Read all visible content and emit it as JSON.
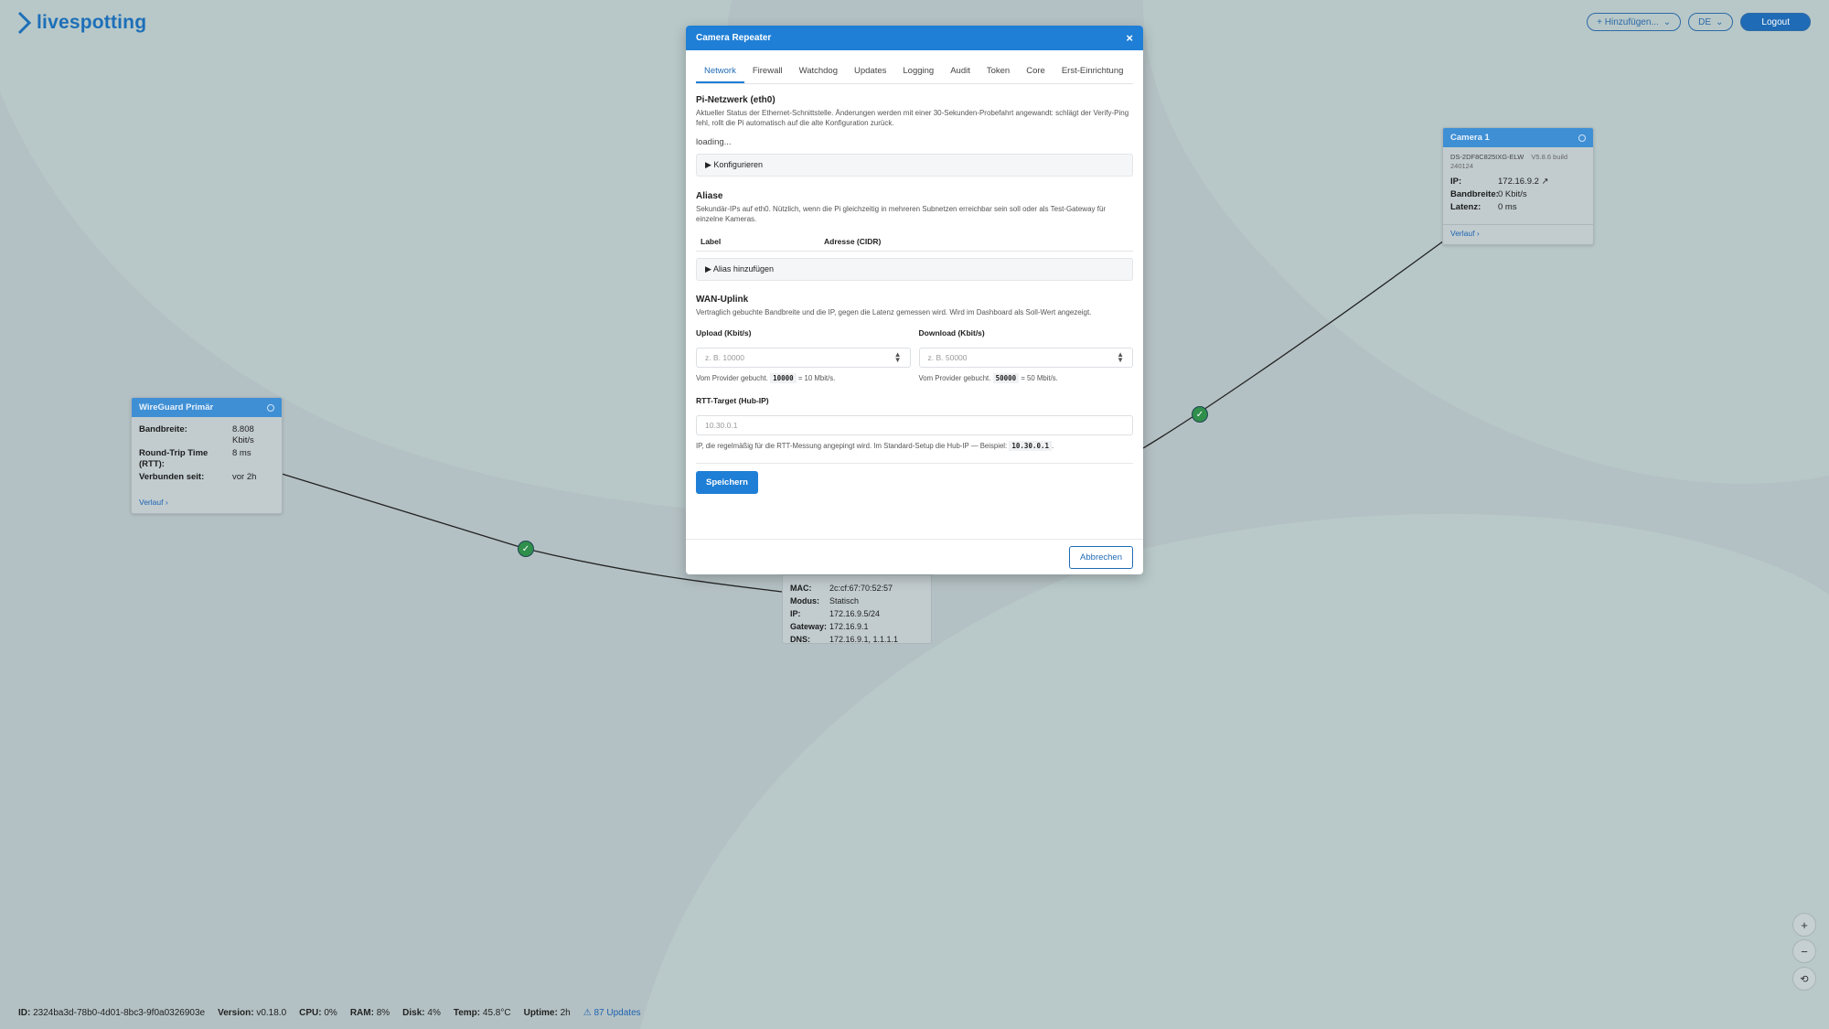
{
  "app": {
    "logo_text": "livespotting"
  },
  "header": {
    "add_label": "+ Hinzufügen...",
    "lang_label": "DE",
    "logout_label": "Logout"
  },
  "node_wireguard": {
    "title": "WireGuard Primär",
    "rows": [
      {
        "k": "Bandbreite:",
        "v": "8.808 Kbit/s"
      },
      {
        "k": "Round-Trip Time (RTT):",
        "v": "8 ms"
      },
      {
        "k": "Verbunden seit:",
        "v": "vor 2h"
      }
    ],
    "link": "Verlauf ›"
  },
  "node_camera": {
    "title": "Camera 1",
    "model": "DS-2DF8C825IXG-ELW",
    "version": "V5.8.6 build 240124",
    "rows": [
      {
        "k": "IP:",
        "v": "172.16.9.2 ↗"
      },
      {
        "k": "Bandbreite:",
        "v": "0 Kbit/s"
      },
      {
        "k": "Latenz:",
        "v": "0 ms"
      }
    ],
    "link": "Verlauf ›"
  },
  "node_repeater_details": {
    "rows": [
      {
        "k": "MAC:",
        "v": "2c:cf:67:70:52:57"
      },
      {
        "k": "Modus:",
        "v": "Statisch"
      },
      {
        "k": "IP:",
        "v": "172.16.9.5/24"
      },
      {
        "k": "Gateway:",
        "v": "172.16.9.1"
      },
      {
        "k": "DNS:",
        "v": "172.16.9.1, 1.1.1.1"
      }
    ]
  },
  "modal": {
    "title": "Camera Repeater",
    "close_glyph": "×",
    "tabs": [
      "Network",
      "Firewall",
      "Watchdog",
      "Updates",
      "Logging",
      "Audit",
      "Token",
      "Core",
      "Erst-Einrichtung"
    ],
    "pi_title": "Pi-Netzwerk (eth0)",
    "pi_desc": "Aktueller Status der Ethernet-Schnittstelle. Änderungen werden mit einer 30-Sekunden-Probefahrt angewandt: schlägt der Verify-Ping fehl, rollt die Pi automatisch auf die alte Konfiguration zurück.",
    "loading": "loading...",
    "configure": "▶ Konfigurieren",
    "alias_title": "Aliase",
    "alias_desc": "Sekundär-IPs auf eth0. Nützlich, wenn die Pi gleichzeitig in mehreren Subnetzen erreichbar sein soll oder als Test-Gateway für einzelne Kameras.",
    "col_label": "Label",
    "col_addr": "Adresse (CIDR)",
    "alias_add": "▶ Alias hinzufügen",
    "wan_title": "WAN-Uplink",
    "wan_desc": "Vertraglich gebuchte Bandbreite und die IP, gegen die Latenz gemessen wird. Wird im Dashboard als Soll-Wert angezeigt.",
    "upload_label": "Upload (Kbit/s)",
    "upload_placeholder": "z. B. 10000",
    "upload_help_pre": "Vom Provider gebucht.",
    "upload_code": "10000",
    "upload_help_post": "= 10 Mbit/s.",
    "download_label": "Download (Kbit/s)",
    "download_placeholder": "z. B. 50000",
    "download_help_pre": "Vom Provider gebucht.",
    "download_code": "50000",
    "download_help_post": "= 50 Mbit/s.",
    "rtt_label": "RTT-Target (Hub-IP)",
    "rtt_placeholder": "10.30.0.1",
    "rtt_help_pre": "IP, die regelmäßig für die RTT-Messung angepingt wird. Im Standard-Setup die Hub-IP — Beispiel:",
    "rtt_code": "10.30.0.1",
    "rtt_help_post": ".",
    "save": "Speichern",
    "cancel": "Abbrechen"
  },
  "status_bar": {
    "id_label": "ID:",
    "id_value": "2324ba3d-78b0-4d01-8bc3-9f0a0326903e",
    "version_label": "Version:",
    "version_value": "v0.18.0",
    "cpu_label": "CPU:",
    "cpu_value": "0%",
    "ram_label": "RAM:",
    "ram_value": "8%",
    "disk_label": "Disk:",
    "disk_value": "4%",
    "temp_label": "Temp:",
    "temp_value": "45.8°C",
    "uptime_label": "Uptime:",
    "uptime_value": "2h",
    "updates": "⚠ 87 Updates"
  },
  "zoom": {
    "in": "+",
    "out": "−",
    "reset": "⟲"
  },
  "colors": {
    "accent": "#1f7fd6",
    "ok": "#2f8f4b",
    "canvas": "#b3c0c3"
  }
}
